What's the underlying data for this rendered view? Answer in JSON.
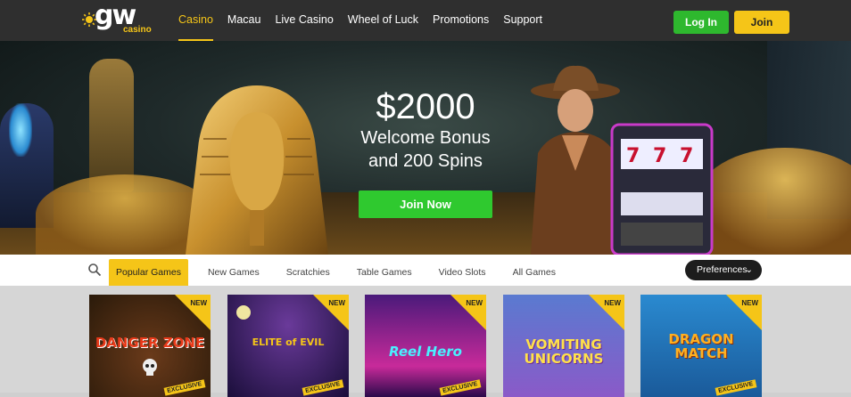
{
  "header": {
    "logo_text": "gw",
    "logo_sub": "casino",
    "nav": [
      "Casino",
      "Macau",
      "Live Casino",
      "Wheel of Luck",
      "Promotions",
      "Support"
    ],
    "active_nav": "Casino",
    "login_label": "Log In",
    "join_label": "Join"
  },
  "hero": {
    "amount": "$2000",
    "line1": "Welcome Bonus",
    "line2": "and 200 Spins",
    "cta_label": "Join Now"
  },
  "filter": {
    "tabs": [
      "Popular Games",
      "New Games",
      "Scratchies",
      "Table Games",
      "Video Slots",
      "All Games"
    ],
    "active_tab": "Popular Games",
    "preferences_label": "Preferences"
  },
  "games": [
    {
      "title": "DANGER ZONE",
      "badge": "NEW",
      "tag": "EXCLUSIVE"
    },
    {
      "title": "ELITE of EVIL",
      "badge": "NEW",
      "tag": "EXCLUSIVE"
    },
    {
      "title": "Reel Hero",
      "badge": "NEW",
      "tag": "EXCLUSIVE"
    },
    {
      "title": "VOMITING UNICORNS",
      "badge": "NEW",
      "tag": ""
    },
    {
      "title": "DRAGON MATCH",
      "badge": "NEW",
      "tag": "EXCLUSIVE"
    }
  ],
  "colors": {
    "brand_yellow": "#f5c518",
    "green": "#2fc92f",
    "header_bg": "#2f2f2f"
  }
}
